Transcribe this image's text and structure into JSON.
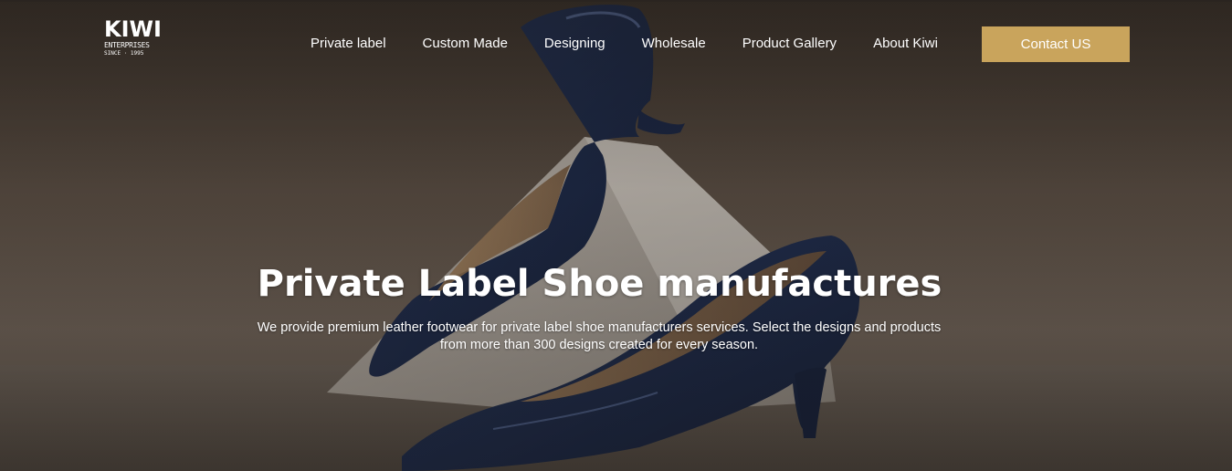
{
  "logo": {
    "main": "KIWI",
    "sub": "ENTERPRISES",
    "since": "SINCE · 1995"
  },
  "nav": {
    "items": [
      {
        "label": "Private label"
      },
      {
        "label": "Custom Made"
      },
      {
        "label": "Designing"
      },
      {
        "label": "Wholesale"
      },
      {
        "label": "Product Gallery"
      },
      {
        "label": "About Kiwi"
      }
    ],
    "contact_label": "Contact US"
  },
  "hero": {
    "title": "Private Label Shoe manufactures",
    "description": "We provide premium leather footwear for private label shoe manufacturers services. Select the designs and products from more than 300 designs created for every season."
  },
  "colors": {
    "accent": "#c9a45c",
    "shoe": "#1d2c4e",
    "background": "#5a4e44"
  },
  "icons": {
    "logo_mark": "leather-hide-icon"
  }
}
